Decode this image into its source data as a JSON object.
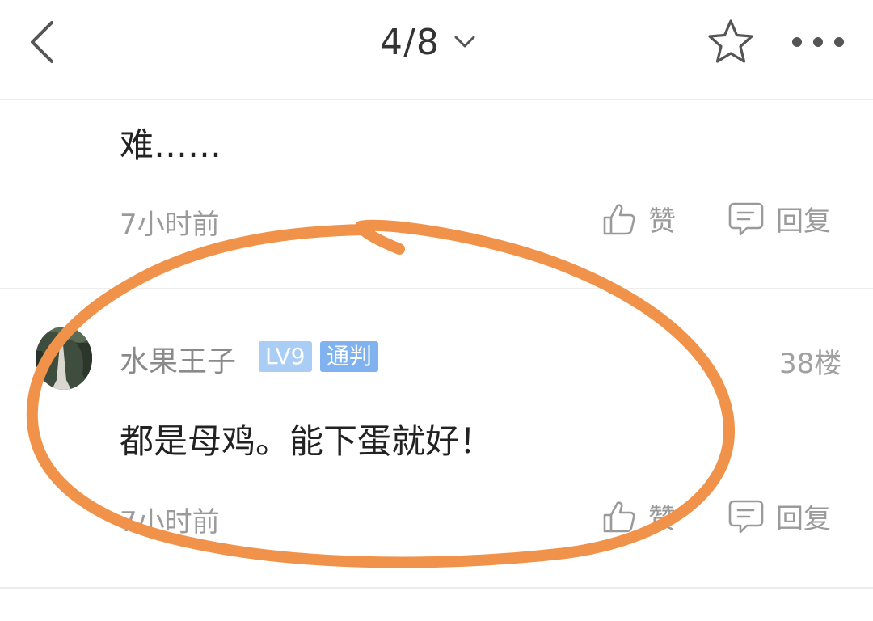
{
  "header": {
    "page_indicator": "4/8",
    "back_icon": "chevron-left-icon",
    "favorite_icon": "star-outline-icon",
    "more_icon": "more-horizontal-icon"
  },
  "comments": [
    {
      "text": "难……",
      "time": "7小时前",
      "like_label": "赞",
      "reply_label": "回复"
    },
    {
      "username": "水果王子",
      "level_badge": "LV9",
      "role_badge": "通判",
      "floor": "38楼",
      "text": "都是母鸡。能下蛋就好！",
      "time": "7小时前",
      "like_label": "赞",
      "reply_label": "回复"
    }
  ],
  "colors": {
    "level_badge": "#a9cdf5",
    "role_badge": "#7fb2ef",
    "annotation_stroke": "#f0924a",
    "meta_text": "#9a9a9a"
  }
}
